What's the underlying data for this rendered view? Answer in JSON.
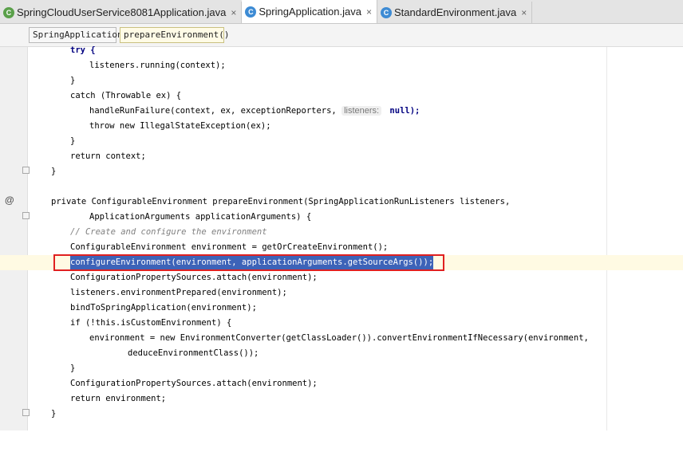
{
  "tabs": [
    {
      "label": "SpringCloudUserService8081Application.java",
      "close": "×",
      "icon": "spring-boot-class-icon"
    },
    {
      "label": "SpringApplication.java",
      "close": "×",
      "icon": "class-icon"
    },
    {
      "label": "StandardEnvironment.java",
      "close": "×",
      "icon": "class-icon"
    }
  ],
  "breadcrumb": {
    "items": [
      "SpringApplication",
      "prepareEnvironment()"
    ]
  },
  "gutter": {
    "annotation_icon": "@"
  },
  "code": {
    "l1": "try {",
    "l2": "listeners.running(context);",
    "l3": "}",
    "l4": "catch (Throwable ex) {",
    "l5a": "handleRunFailure(context, ex, exceptionReporters, ",
    "l5hint": "listeners:",
    "l5b": " null);",
    "l6": "throw new IllegalStateException(ex);",
    "l7": "}",
    "l8": "return context;",
    "l9": "}",
    "l10": "private ConfigurableEnvironment prepareEnvironment(SpringApplicationRunListeners listeners,",
    "l11": "ApplicationArguments applicationArguments) {",
    "l12": "// Create and configure the environment",
    "l13": "ConfigurableEnvironment environment = getOrCreateEnvironment();",
    "l14": "configureEnvironment(environment, applicationArguments.getSourceArgs());",
    "l15": "ConfigurationPropertySources.attach(environment);",
    "l16": "listeners.environmentPrepared(environment);",
    "l17": "bindToSpringApplication(environment);",
    "l18": "if (!this.isCustomEnvironment) {",
    "l19": "environment = new EnvironmentConverter(getClassLoader()).convertEnvironmentIfNecessary(environment,",
    "l20": "deduceEnvironmentClass());",
    "l21": "}",
    "l22": "ConfigurationPropertySources.attach(environment);",
    "l23": "return environment;",
    "l24": "}"
  }
}
